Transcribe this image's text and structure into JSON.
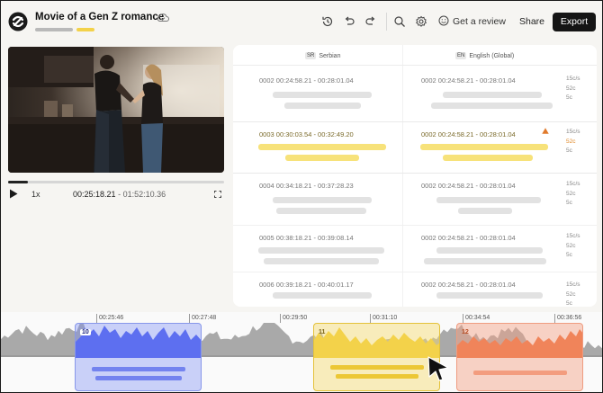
{
  "app": {
    "title": "Movie of a Gen Z romance",
    "toolbar": {
      "history_icon": "history-icon",
      "undo_icon": "undo-icon",
      "redo_icon": "redo-icon",
      "search_icon": "search-icon",
      "settings_icon": "gear-icon",
      "review_label": "Get a review",
      "share_label": "Share",
      "export_label": "Export"
    }
  },
  "player": {
    "speed": "1x",
    "current_time": "00:25:18.21",
    "total_time": "01:52:10.36",
    "progress": 0.09
  },
  "subtitles": {
    "source_lang": {
      "code": "SR",
      "name": "Serbian"
    },
    "target_lang": {
      "code": "EN",
      "name": "English (Global)"
    },
    "rows": [
      {
        "src_time": "0002  00:24:58.21 - 00:28:01.04",
        "tgt_time": "0002  00:24:58.21 - 00:28:01.04",
        "stats": [
          "15c/s",
          "52c",
          "5c"
        ],
        "selected": false,
        "warning": false
      },
      {
        "src_time": "0003  00:30:03.54 - 00:32:49.20",
        "tgt_time": "0002  00:24:58.21 - 00:28:01.04",
        "stats": [
          "15c/s",
          "52c",
          "5c"
        ],
        "selected": true,
        "warning": true
      },
      {
        "src_time": "0004  00:34:18.21 - 00:37:28.23",
        "tgt_time": "0002  00:24:58.21 - 00:28:01.04",
        "stats": [
          "15c/s",
          "52c",
          "5c"
        ],
        "selected": false,
        "warning": false
      },
      {
        "src_time": "0005  00:38:18.21 - 00:39:08.14",
        "tgt_time": "0002  00:24:58.21 - 00:28:01.04",
        "stats": [
          "15c/s",
          "52c",
          "5c"
        ],
        "selected": false,
        "warning": false
      },
      {
        "src_time": "0006  00:39:18.21 - 00:40:01.17",
        "tgt_time": "0002  00:24:58.21 - 00:28:01.04",
        "stats": [
          "15c/s",
          "52c",
          "5c"
        ],
        "selected": false,
        "warning": false
      }
    ]
  },
  "timeline": {
    "ticks": [
      "00:25:46",
      "00:27:48",
      "00:29:50",
      "00:31:10",
      "00:34:54",
      "00:36:56"
    ],
    "clips": [
      {
        "number": "10",
        "color": "#6f7ff0"
      },
      {
        "number": "11",
        "color": "#f2cc3a"
      },
      {
        "number": "12",
        "color": "#f08a60"
      }
    ]
  }
}
